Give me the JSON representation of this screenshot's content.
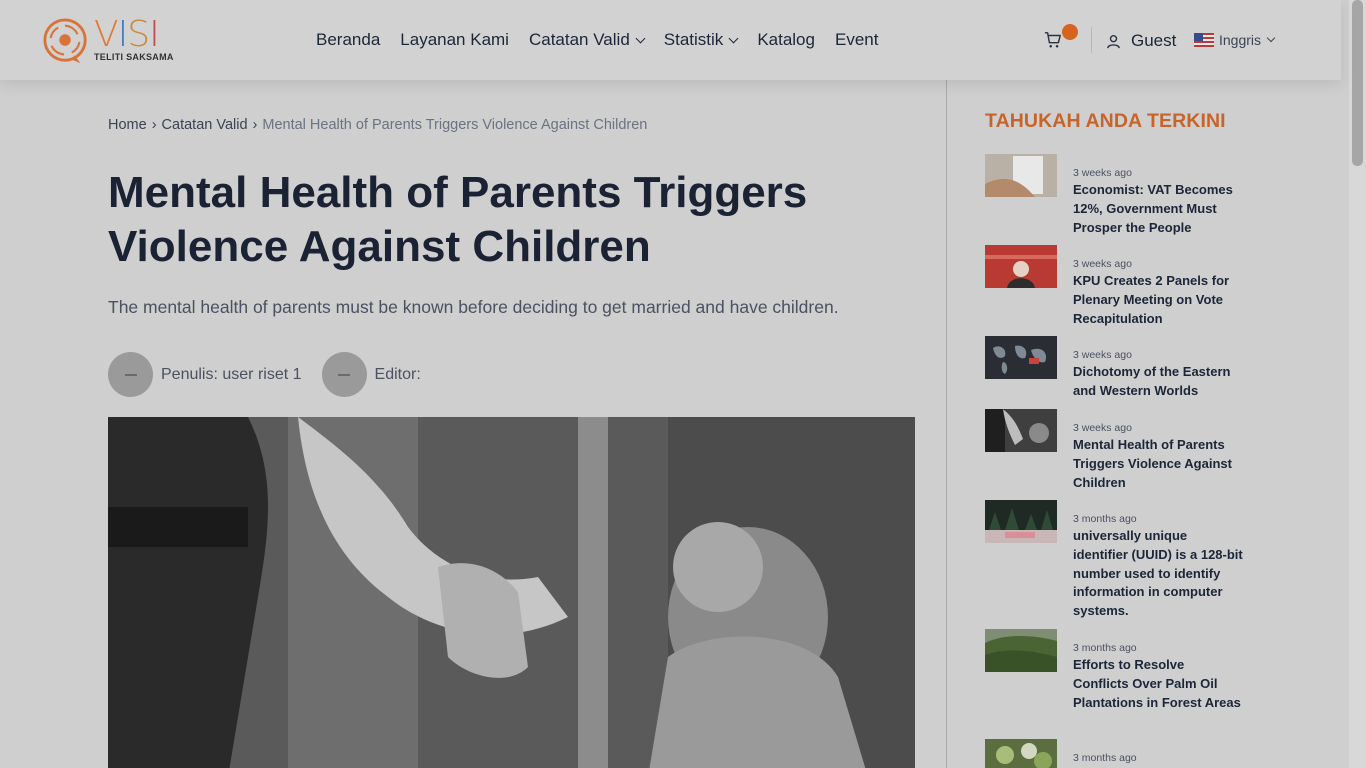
{
  "header": {
    "logo_word": [
      "V",
      "I",
      "S",
      "I"
    ],
    "logo_tagline": "TELITI SAKSAMA",
    "nav": [
      {
        "label": "Beranda",
        "has_dropdown": false
      },
      {
        "label": "Layanan Kami",
        "has_dropdown": false
      },
      {
        "label": "Catatan Valid",
        "has_dropdown": true
      },
      {
        "label": "Statistik",
        "has_dropdown": true
      },
      {
        "label": "Katalog",
        "has_dropdown": false
      },
      {
        "label": "Event",
        "has_dropdown": false
      }
    ],
    "cart_icon": "cart-icon",
    "user_icon": "user-icon",
    "user_label": "Guest",
    "language_label": "Inggris",
    "accent_color": "#d66420"
  },
  "breadcrumb": {
    "items": [
      "Home",
      "Catatan Valid"
    ],
    "current": "Mental Health of Parents Triggers Violence Against Children",
    "separator": "›"
  },
  "article": {
    "title": "Mental Health of Parents Triggers Violence Against Children",
    "subtitle": "The mental health of parents must be known before deciding to get married and have children.",
    "writer": "Penulis: user riset 1",
    "editor": "Editor:"
  },
  "sidebar": {
    "title": "TAHUKAH ANDA TERKINI",
    "title_color": "#c8642a",
    "items": [
      {
        "time": "3 weeks ago",
        "title": "Economist: VAT Becomes 12%, Government Must Prosper the People"
      },
      {
        "time": "3 weeks ago",
        "title": "KPU Creates 2 Panels for Plenary Meeting on Vote Recapitulation"
      },
      {
        "time": "3 weeks ago",
        "title": "Dichotomy of the Eastern and Western Worlds"
      },
      {
        "time": "3 weeks ago",
        "title": "Mental Health of Parents Triggers Violence Against Children"
      },
      {
        "time": "3 months ago",
        "title": "universally unique identifier (UUID) is a 128-bit number used to identify information in computer systems."
      },
      {
        "time": "3 months ago",
        "title": "Efforts to Resolve Conflicts Over Palm Oil Plantations in Forest Areas"
      },
      {
        "time": "3 months ago",
        "title": ""
      }
    ]
  }
}
